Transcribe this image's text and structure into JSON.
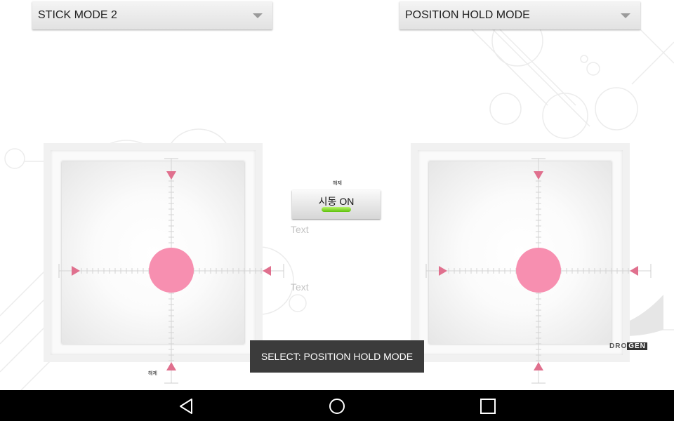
{
  "dropdowns": {
    "stick_mode": "STICK MODE 2",
    "flight_mode": "POSITION HOLD MODE"
  },
  "start_button": {
    "caption": "해제",
    "label": "시동 ON",
    "indicator_color": "#7ddc27"
  },
  "text_fields": [
    "Text",
    "Text"
  ],
  "left_stick_caption": "해제",
  "toast": "SELECT: POSITION HOLD MODE",
  "logo": {
    "part1": "DRO",
    "part2": "GEN"
  },
  "colors": {
    "knob": "#f78fb0",
    "arrow": "#e0708e",
    "toast_bg": "#3b3b3b",
    "nav_bar": "#000000"
  },
  "nav": {
    "back_icon": "triangle-back-icon",
    "home_icon": "circle-home-icon",
    "recents_icon": "square-recents-icon"
  }
}
